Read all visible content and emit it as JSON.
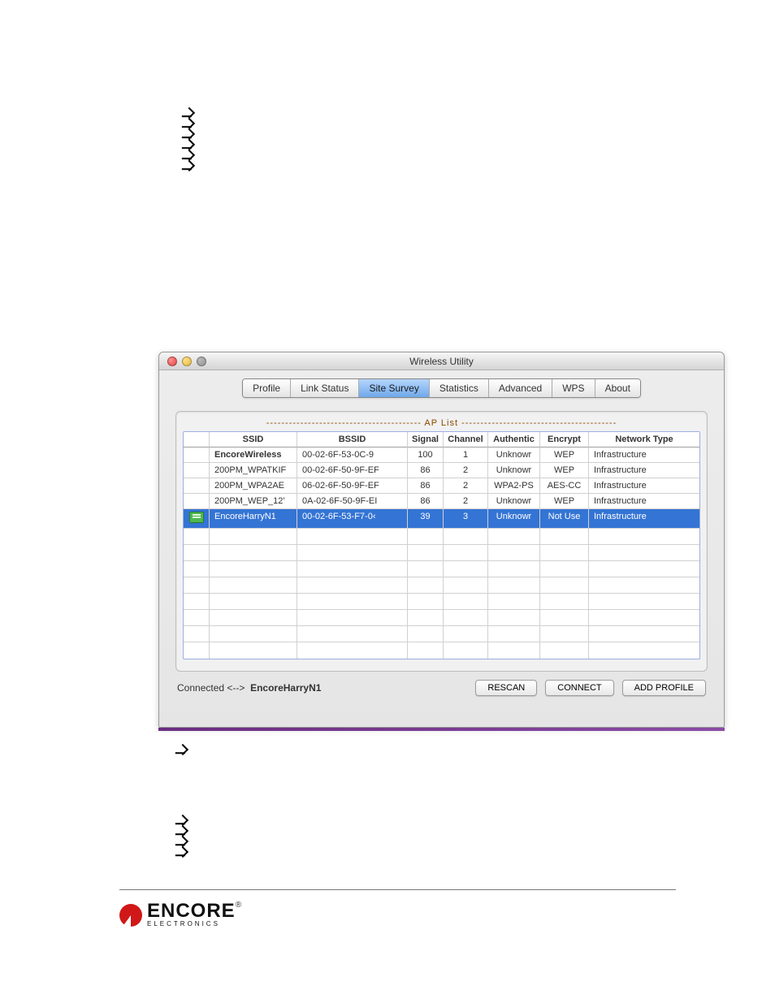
{
  "window": {
    "title": "Wireless Utility",
    "tabs": [
      {
        "label": "Profile"
      },
      {
        "label": "Link Status"
      },
      {
        "label": "Site Survey"
      },
      {
        "label": "Statistics"
      },
      {
        "label": "Advanced"
      },
      {
        "label": "WPS"
      },
      {
        "label": "About"
      }
    ],
    "active_tab": 2,
    "ap_list_label": "----------------------------------------- AP List -----------------------------------------",
    "columns": {
      "ssid": "SSID",
      "bssid": "BSSID",
      "signal": "Signal",
      "channel": "Channel",
      "auth": "Authentic",
      "encrypt": "Encrypt",
      "net": "Network Type"
    },
    "rows": [
      {
        "icon": "",
        "ssid": "EncoreWireless",
        "bssid": "00-02-6F-53-0C-9",
        "signal": "100",
        "channel": "1",
        "auth": "Unknowr",
        "encrypt": "WEP",
        "net": "Infrastructure",
        "bold_ssid": true,
        "selected": false
      },
      {
        "icon": "",
        "ssid": "200PM_WPATKIF",
        "bssid": "00-02-6F-50-9F-EF",
        "signal": "86",
        "channel": "2",
        "auth": "Unknowr",
        "encrypt": "WEP",
        "net": "Infrastructure",
        "selected": false
      },
      {
        "icon": "",
        "ssid": "200PM_WPA2AE",
        "bssid": "06-02-6F-50-9F-EF",
        "signal": "86",
        "channel": "2",
        "auth": "WPA2-PS",
        "encrypt": "AES-CC",
        "net": "Infrastructure",
        "selected": false
      },
      {
        "icon": "",
        "ssid": "200PM_WEP_12’",
        "bssid": "0A-02-6F-50-9F-EI",
        "signal": "86",
        "channel": "2",
        "auth": "Unknowr",
        "encrypt": "WEP",
        "net": "Infrastructure",
        "selected": false
      },
      {
        "icon": "connected",
        "ssid": "EncoreHarryN1",
        "bssid": "00-02-6F-53-F7-0‹",
        "signal": "39",
        "channel": "3",
        "auth": "Unknowr",
        "encrypt": "Not Use",
        "net": "Infrastructure",
        "selected": true
      }
    ],
    "empty_rows": 8,
    "status": {
      "label": "Connected <-->",
      "ssid": "EncoreHarryN1"
    },
    "buttons": {
      "rescan": "RESCAN",
      "connect": "CONNECT",
      "add_profile": "ADD PROFILE"
    }
  },
  "logo": {
    "brand": "ENCORE",
    "sub": "ELECTRONICS"
  }
}
